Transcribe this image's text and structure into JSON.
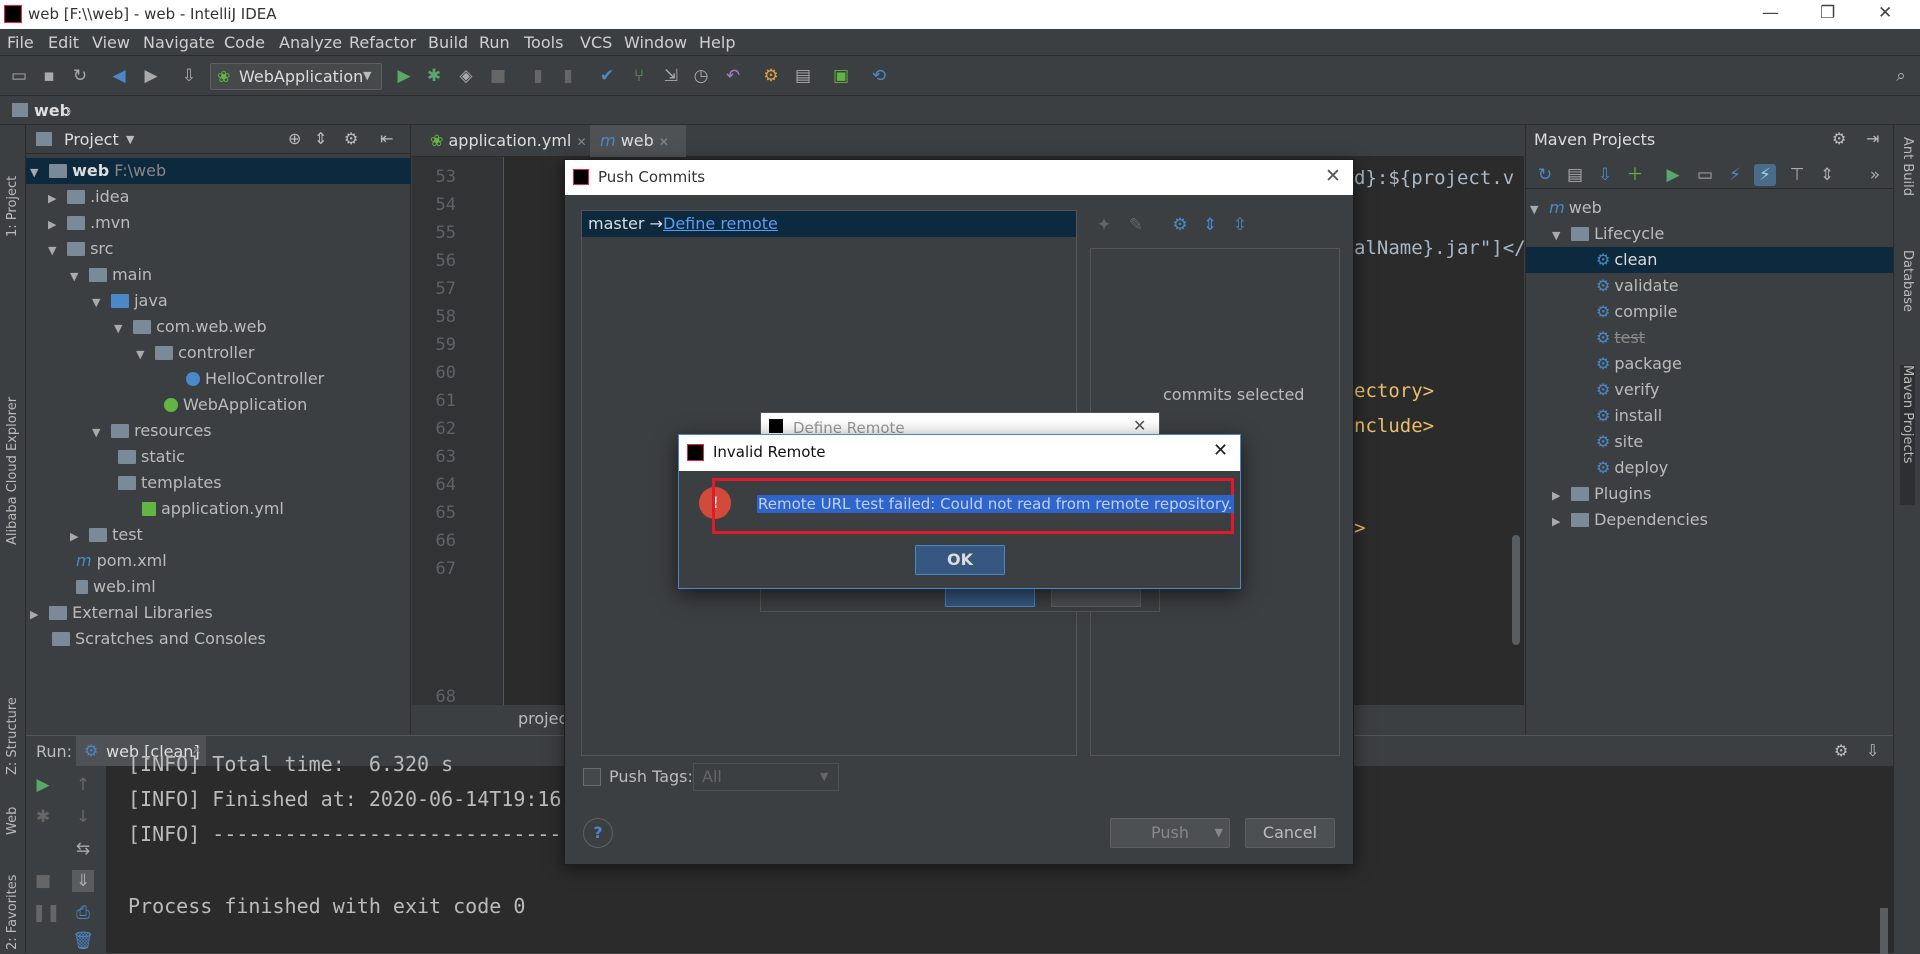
{
  "window": {
    "title": "web [F:\\\\web] - web - IntelliJ IDEA",
    "min": "—",
    "restore": "❐",
    "close": "✕"
  },
  "menu": [
    "File",
    "Edit",
    "View",
    "Navigate",
    "Code",
    "Analyze",
    "Refactor",
    "Build",
    "Run",
    "Tools",
    "VCS",
    "Window",
    "Help"
  ],
  "toolbar": {
    "run_config": "WebApplication"
  },
  "navbar": {
    "crumb": "web"
  },
  "left_stripe": {
    "project": "1: Project",
    "alibaba": "Alibaba Cloud Explorer",
    "structure": "Z: Structure",
    "web": "Web",
    "favorites": "2: Favorites"
  },
  "project": {
    "header": "Project",
    "tree": [
      {
        "label": "web",
        "suffix": "F:\\web"
      },
      {
        "label": ".idea"
      },
      {
        "label": ".mvn"
      },
      {
        "label": "src"
      },
      {
        "label": "main"
      },
      {
        "label": "java"
      },
      {
        "label": "com.web.web"
      },
      {
        "label": "controller"
      },
      {
        "label": "HelloController"
      },
      {
        "label": "WebApplication"
      },
      {
        "label": "resources"
      },
      {
        "label": "static"
      },
      {
        "label": "templates"
      },
      {
        "label": "application.yml"
      },
      {
        "label": "test"
      },
      {
        "label": "pom.xml"
      },
      {
        "label": "web.iml"
      },
      {
        "label": "External Libraries"
      },
      {
        "label": "Scratches and Consoles"
      }
    ]
  },
  "editor": {
    "tabs": [
      {
        "label": "application.yml"
      },
      {
        "label": "web"
      }
    ],
    "line_numbers": [
      "53",
      "54",
      "55",
      "56",
      "57",
      "58",
      "59",
      "60",
      "61",
      "62",
      "63",
      "64",
      "65",
      "66",
      "67",
      "68"
    ],
    "code_fragments": [
      "d}:${project.v",
      "alName}.jar\"]</",
      "ectory>",
      "nclude>",
      ">"
    ],
    "breadcrumb": "projec"
  },
  "maven": {
    "header": "Maven Projects",
    "tree": [
      {
        "label": "web"
      },
      {
        "label": "Lifecycle"
      },
      {
        "label": "clean"
      },
      {
        "label": "validate"
      },
      {
        "label": "compile"
      },
      {
        "label": "test"
      },
      {
        "label": "package"
      },
      {
        "label": "verify"
      },
      {
        "label": "install"
      },
      {
        "label": "site"
      },
      {
        "label": "deploy"
      },
      {
        "label": "Plugins"
      },
      {
        "label": "Dependencies"
      }
    ]
  },
  "right_stripe": {
    "ant": "Ant Build",
    "database": "Database",
    "maven": "Maven Projects"
  },
  "run": {
    "label": "Run:",
    "tab": "web [clean]",
    "lines": [
      "[INFO] Total time:  6.320 s",
      "[INFO] Finished at: 2020-06-14T19:16",
      "[INFO] -------------------------------",
      "",
      "Process finished with exit code 0"
    ]
  },
  "push_dialog": {
    "title": "Push Commits",
    "branch": "master →",
    "define_remote": "Define remote",
    "commits_selected": "commits selected",
    "push_tags": "Push Tags:",
    "tags_value": "All",
    "push": "Push",
    "cancel": "Cancel",
    "help": "?"
  },
  "define_remote_dialog": {
    "title": "Define Remote"
  },
  "invalid_remote": {
    "title": "Invalid Remote",
    "message": "Remote URL test failed: Could not read from remote repository.",
    "ok": "OK"
  }
}
